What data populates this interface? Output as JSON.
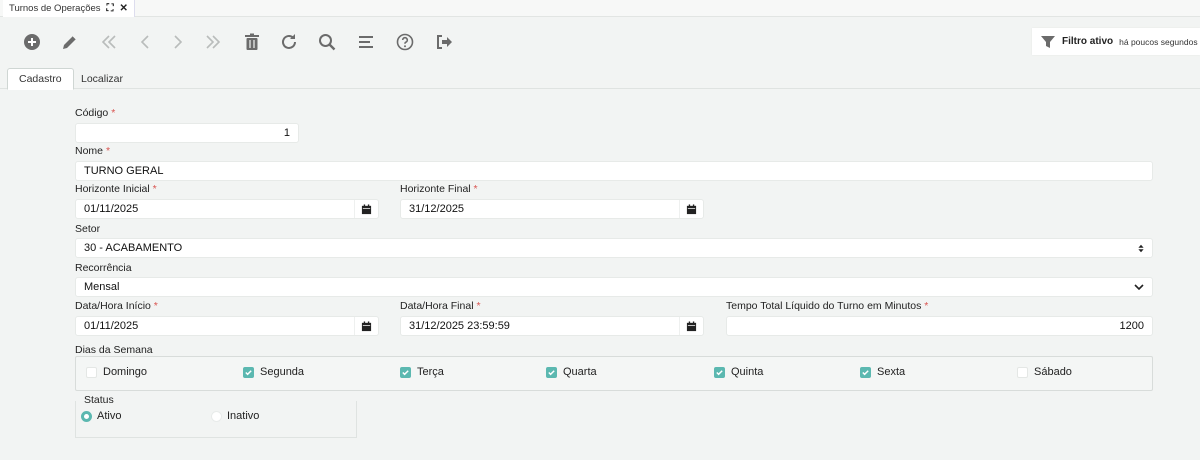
{
  "window": {
    "tab_title": "Turnos de Operações"
  },
  "toolbar": {
    "buttons": [
      {
        "name": "add-button",
        "icon": "plus-circle-icon"
      },
      {
        "name": "edit-button",
        "icon": "pencil-icon"
      },
      {
        "name": "first-record-button",
        "icon": "double-chevron-left-icon"
      },
      {
        "name": "previous-record-button",
        "icon": "chevron-left-icon"
      },
      {
        "name": "next-record-button",
        "icon": "chevron-right-icon"
      },
      {
        "name": "last-record-button",
        "icon": "double-chevron-right-icon"
      },
      {
        "name": "delete-button",
        "icon": "trash-icon"
      },
      {
        "name": "refresh-button",
        "icon": "refresh-icon"
      },
      {
        "name": "search-button",
        "icon": "search-icon"
      },
      {
        "name": "list-button",
        "icon": "list-icon"
      },
      {
        "name": "help-button",
        "icon": "question-circle-icon"
      },
      {
        "name": "exit-button",
        "icon": "sign-out-icon"
      }
    ]
  },
  "filter": {
    "label": "Filtro ativo",
    "time": "há poucos segundos"
  },
  "tabs": [
    {
      "label": "Cadastro",
      "active": true
    },
    {
      "label": "Localizar",
      "active": false
    }
  ],
  "form": {
    "required_mark": "*",
    "codigo": {
      "label": "Código",
      "value": "1"
    },
    "nome": {
      "label": "Nome",
      "value": "TURNO GERAL"
    },
    "horizonte_inicial": {
      "label": "Horizonte Inicial",
      "value": "01/11/2025"
    },
    "horizonte_final": {
      "label": "Horizonte Final",
      "value": "31/12/2025"
    },
    "setor": {
      "label": "Setor",
      "value": "30 - ACABAMENTO"
    },
    "recorrencia": {
      "label": "Recorrência",
      "value": "Mensal"
    },
    "data_hora_inicio": {
      "label": "Data/Hora Início",
      "value": "01/11/2025"
    },
    "data_hora_final": {
      "label": "Data/Hora Final",
      "value": "31/12/2025 23:59:59"
    },
    "tempo_total": {
      "label": "Tempo Total Líquido do Turno em Minutos",
      "value": "1200"
    },
    "dias_label": "Dias da Semana",
    "dias": [
      {
        "label": "Domingo",
        "checked": false
      },
      {
        "label": "Segunda",
        "checked": true
      },
      {
        "label": "Terça",
        "checked": true
      },
      {
        "label": "Quarta",
        "checked": true
      },
      {
        "label": "Quinta",
        "checked": true
      },
      {
        "label": "Sexta",
        "checked": true
      },
      {
        "label": "Sábado",
        "checked": false
      }
    ],
    "status": {
      "label": "Status",
      "options": [
        {
          "label": "Ativo",
          "selected": true
        },
        {
          "label": "Inativo",
          "selected": false
        }
      ]
    }
  },
  "colors": {
    "accent": "#5bb8b0",
    "required": "#d9534f",
    "icon": "#6b6b6b",
    "icon_disabled": "#b9bcbb"
  }
}
